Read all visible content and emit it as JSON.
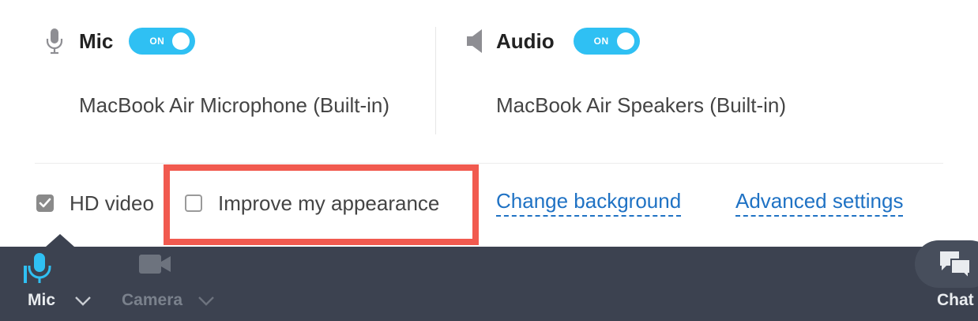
{
  "mic": {
    "title": "Mic",
    "toggle_label": "ON",
    "toggle_state": "on",
    "device": "MacBook Air Microphone (Built-in)",
    "icon": "microphone-icon"
  },
  "audio": {
    "title": "Audio",
    "toggle_label": "ON",
    "toggle_state": "on",
    "device": "MacBook Air Speakers (Built-in)",
    "icon": "speaker-icon"
  },
  "options": {
    "hd_video": {
      "label": "HD video",
      "checked": true
    },
    "improve_appearance": {
      "label": "Improve my appearance",
      "checked": false
    }
  },
  "links": {
    "change_background": "Change background",
    "advanced_settings": "Advanced settings"
  },
  "toolbar": {
    "mic_label": "Mic",
    "camera_label": "Camera",
    "chat_label": "Chat"
  },
  "colors": {
    "accent": "#2fc0f3",
    "link": "#1f72c4",
    "highlight": "#f15a4f",
    "toolbar_bg": "#3c4250"
  }
}
